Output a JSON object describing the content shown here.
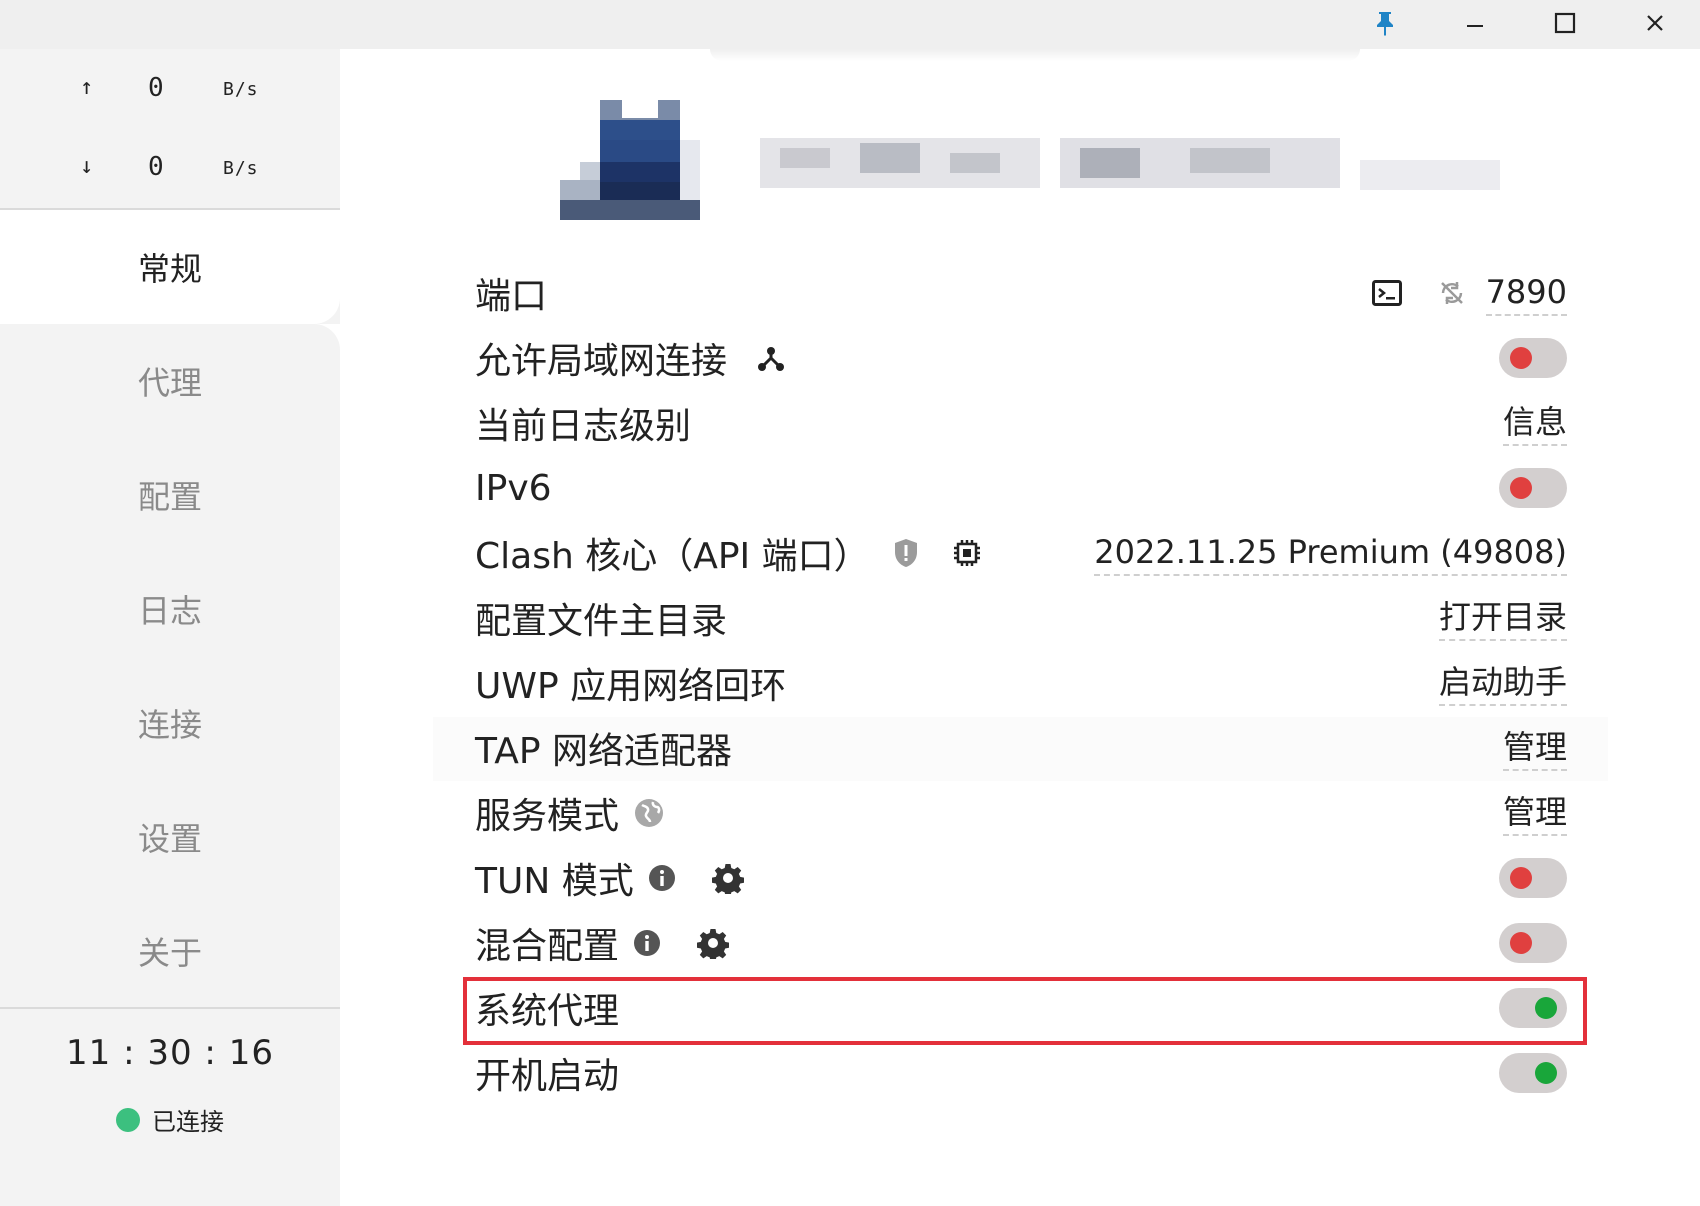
{
  "window": {
    "pin_icon": "pin-icon",
    "min_icon": "minimize-icon",
    "max_icon": "maximize-icon",
    "close_icon": "close-icon",
    "pin_color": "#1f84c6"
  },
  "sidebar": {
    "traffic": {
      "up": {
        "arrow": "↑",
        "value": "0",
        "unit": "B/s"
      },
      "down": {
        "arrow": "↓",
        "value": "0",
        "unit": "B/s"
      }
    },
    "nav": [
      {
        "label": "常规",
        "active": true
      },
      {
        "label": "代理"
      },
      {
        "label": "配置"
      },
      {
        "label": "日志"
      },
      {
        "label": "连接"
      },
      {
        "label": "设置"
      },
      {
        "label": "关于"
      }
    ],
    "clock": "11 : 30 : 16",
    "status": {
      "label": "已连接",
      "color": "#3cc07f"
    }
  },
  "settings": {
    "port": {
      "label": "端口",
      "value": "7890",
      "icons": [
        "terminal-icon",
        "sync-off-icon"
      ]
    },
    "allow_lan": {
      "label": "允许局域网连接",
      "icon": "network-icon",
      "enabled": false
    },
    "log_level": {
      "label": "当前日志级别",
      "value": "信息"
    },
    "ipv6": {
      "label": "IPv6",
      "enabled": false
    },
    "clash_core": {
      "label": "Clash 核心（API 端口）",
      "value": "2022.11.25 Premium (49808)",
      "icons": [
        "shield-icon",
        "chip-icon"
      ]
    },
    "config_dir": {
      "label": "配置文件主目录",
      "value": "打开目录"
    },
    "uwp_loopback": {
      "label": "UWP 应用网络回环",
      "value": "启动助手"
    },
    "tap_adapter": {
      "label": "TAP 网络适配器",
      "value": "管理"
    },
    "service_mode": {
      "label": "服务模式",
      "value": "管理",
      "icon": "globe-icon"
    },
    "tun_mode": {
      "label": "TUN 模式",
      "enabled": false,
      "icons": [
        "info-icon",
        "gear-icon"
      ]
    },
    "mixin": {
      "label": "混合配置",
      "enabled": false,
      "icons": [
        "info-icon",
        "gear-icon"
      ]
    },
    "system_proxy": {
      "label": "系统代理",
      "enabled": true,
      "highlighted": true
    },
    "autostart": {
      "label": "开机启动",
      "enabled": true
    }
  },
  "colors": {
    "toggle_off_knob": "#e0403f",
    "toggle_on_knob": "#19a63a",
    "toggle_track": "#d3cfcf",
    "highlight_border": "#e3303a",
    "sidebar_bg": "#f3f3f3"
  }
}
